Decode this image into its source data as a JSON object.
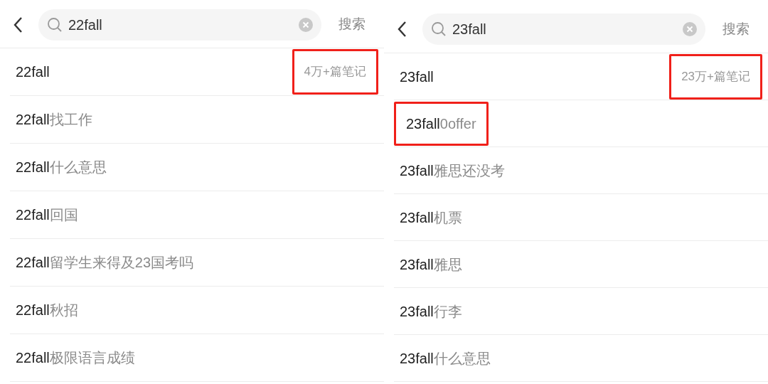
{
  "panels": [
    {
      "query": "22fall",
      "search_button": "搜索",
      "suggestions": [
        {
          "match": "22fall",
          "count": "4万+篇笔记",
          "count_boxed": true,
          "text_boxed": false
        },
        {
          "match": "22fall",
          "rest": "找工作",
          "text_boxed": false
        },
        {
          "match": "22fall",
          "rest": "什么意思",
          "text_boxed": false
        },
        {
          "match": "22fall",
          "rest": "回国",
          "text_boxed": false
        },
        {
          "match": "22fall",
          "rest": "留学生来得及23国考吗",
          "text_boxed": false
        },
        {
          "match": "22fall",
          "rest": "秋招",
          "text_boxed": false
        },
        {
          "match": "22fall",
          "rest": "极限语言成绩",
          "text_boxed": false
        }
      ]
    },
    {
      "query": "23fall",
      "search_button": "搜索",
      "suggestions": [
        {
          "match": "23fall",
          "count": "23万+篇笔记",
          "count_boxed": true,
          "text_boxed": false
        },
        {
          "match": "23fall",
          "rest": "0offer",
          "text_boxed": true
        },
        {
          "match": "23fall",
          "rest": "雅思还没考",
          "text_boxed": false
        },
        {
          "match": "23fall",
          "rest": "机票",
          "text_boxed": false
        },
        {
          "match": "23fall",
          "rest": "雅思",
          "text_boxed": false
        },
        {
          "match": "23fall",
          "rest": "行李",
          "text_boxed": false
        },
        {
          "match": "23fall",
          "rest": "什么意思",
          "text_boxed": false
        }
      ]
    }
  ]
}
